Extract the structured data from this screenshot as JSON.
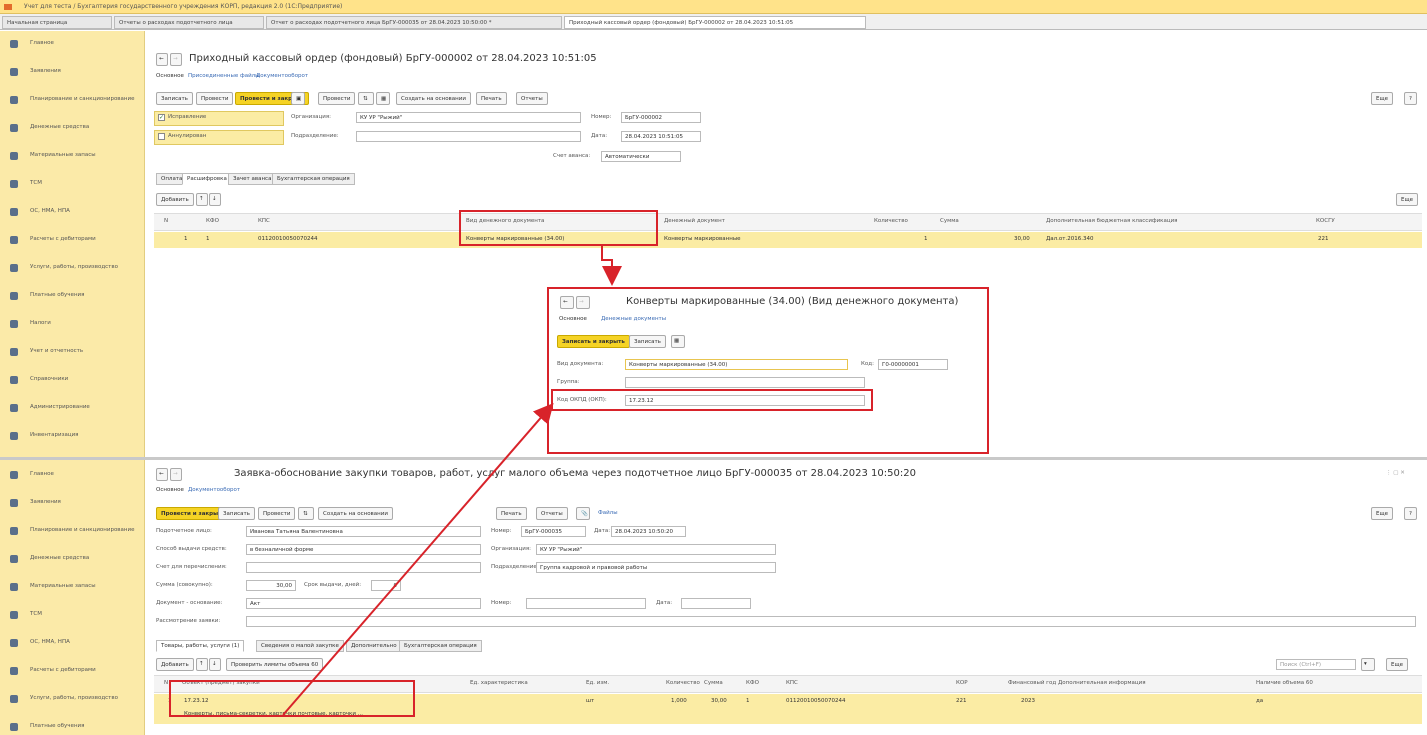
{
  "window_title": "Учет для теста / Бухгалтерия государственного учреждения КОРП, редакция 2.0 (1С:Предприятие)",
  "tabs": [
    "Начальная страница",
    "Отчеты о расходах подотчетного лица",
    "Отчет о расходах подотчетного лица БрГУ-000035 от 28.04.2023 10:50:00 *",
    "Приходный кассовый ордер (фондовый) БрГУ-000002 от 28.04.2023 10:51:05"
  ],
  "sidebar": [
    "Главное",
    "Заявления",
    "Планирование и санкционирование",
    "Денежные средства",
    "Материальные запасы",
    "ТСМ",
    "ОС, НМА, НПА",
    "Расчеты с дебиторами",
    "Услуги, работы, производство",
    "Платные обучения",
    "Налоги",
    "Учет и отчетность",
    "Справочники",
    "Администрирование",
    "Инвентаризация"
  ],
  "sidebar2": [
    "Главное",
    "Заявления",
    "Планирование и санкционирование",
    "Денежные средства",
    "Материальные запасы",
    "ТСМ",
    "ОС, НМА, НПА",
    "Расчеты с дебиторами",
    "Услуги, работы, производство",
    "Платные обучения"
  ],
  "pko": {
    "title": "Приходный кассовый ордер (фондовый) БрГУ-000002 от 28.04.2023 10:51:05",
    "nav": [
      "Основное",
      "Присоединенные файлы",
      "Документооборот"
    ],
    "buttons": [
      "Записать",
      "Провести",
      "Провести и закрыть",
      "Провести",
      "Создать на основании",
      "Печать",
      "Отчеты"
    ],
    "more": "Еще",
    "help": "?",
    "chk1": "Исправление",
    "chk2": "Аннулирован",
    "org_label": "Организация:",
    "org_value": "КУ УР \"Рыжий\"",
    "num_label": "Номер:",
    "num_value": "БрГУ-000002",
    "sub_label": "Подразделение:",
    "date_label": "Дата:",
    "date_value": "28.04.2023 10:51:05",
    "accept_label": "Счет аванса:",
    "accept_value": "Автоматически",
    "pagetabs": [
      "Оплата",
      "Расшифровка",
      "Зачет аванса",
      "Бухгалтерская операция"
    ],
    "add": "Добавить",
    "table_headers": [
      "N",
      "КФО",
      "КПС",
      "Вид денежного документа",
      "Денежный документ",
      "Количество",
      "Сумма",
      "Дополнительная бюджетная классификация",
      "КОСГУ"
    ],
    "row": [
      "1",
      "1",
      "01120010050070244",
      "Конверты маркированные (34.00)",
      "Конверты маркированные",
      "1",
      "30,00",
      "Дал.от.2016.340",
      "221"
    ]
  },
  "popup": {
    "title": "Конверты маркированные (34.00) (Вид денежного документа)",
    "nav": [
      "Основное",
      "Денежные документы"
    ],
    "save_close": "Записать и закрыть",
    "save": "Записать",
    "kind_label": "Вид документа:",
    "kind_value": "Конверты маркированные (34.00)",
    "code_label": "Код:",
    "code_value": "Г0-00000001",
    "group_label": "Группа:",
    "okpd_label": "Код ОКПД (ОКП):",
    "okpd_value": "17.23.12"
  },
  "zayavka": {
    "title": "Заявка-обоснование закупки товаров, работ, услуг малого объема через подотчетное лицо БрГУ-000035 от 28.04.2023 10:50:20",
    "nav": [
      "Основное",
      "Документооборот"
    ],
    "buttons": [
      "Провести и закрыть",
      "Записать",
      "Провести",
      "Создать на основании",
      "Печать",
      "Отчеты",
      "Файлы"
    ],
    "more": "Еще",
    "help": "?",
    "person_label": "Подотчетное лицо:",
    "person_value": "Иванова Татьяна Валентиновна",
    "num_label": "Номер:",
    "num_value": "БрГУ-000035",
    "date_label": "Дата:",
    "date_value": "28.04.2023 10:50:20",
    "method_label": "Способ выдачи средств:",
    "method_value": "в безналичной форме",
    "org_label": "Организация:",
    "org_value": "КУ УР \"Рыжий\"",
    "acc_label": "Счет для перечисления:",
    "sub_label": "Подразделение:",
    "sub_value": "Группа кадровой и правовой работы",
    "sum_label": "Сумма (совокупно):",
    "sum_value": "30,00",
    "term_label": "Срок выдачи, дней:",
    "term_value": "0",
    "doc_label": "Документ - основание:",
    "doc_value": "Акт",
    "number2_label": "Номер:",
    "date2_label": "Дата:",
    "reason_label": "Рассмотрение заявки:",
    "pagetabs": [
      "Товары, работы, услуги (1)",
      "Сведения о малой закупке",
      "Дополнительно",
      "Бухгалтерская операция"
    ],
    "add": "Добавить",
    "check": "Проверить лимиты объема 60",
    "search_placeholder": "Поиск (Ctrl+F)",
    "table_headers": [
      "N",
      "Объект (предмет) закупки",
      "Ед. характеристика",
      "Ед. изм.",
      "Количество",
      "Сумма",
      "КФО",
      "КПС",
      "КОР",
      "Финансовый год",
      "Дополнительная информация",
      "Наличие объема 60"
    ],
    "row": [
      "1",
      "17.23.12",
      "",
      "шт",
      "1,000",
      "30,00",
      "1",
      "01120010050070244",
      "221",
      "2023",
      "",
      "да"
    ],
    "row_note": "Конверты, письма-секретки, карточки почтовые, карточки ..."
  }
}
